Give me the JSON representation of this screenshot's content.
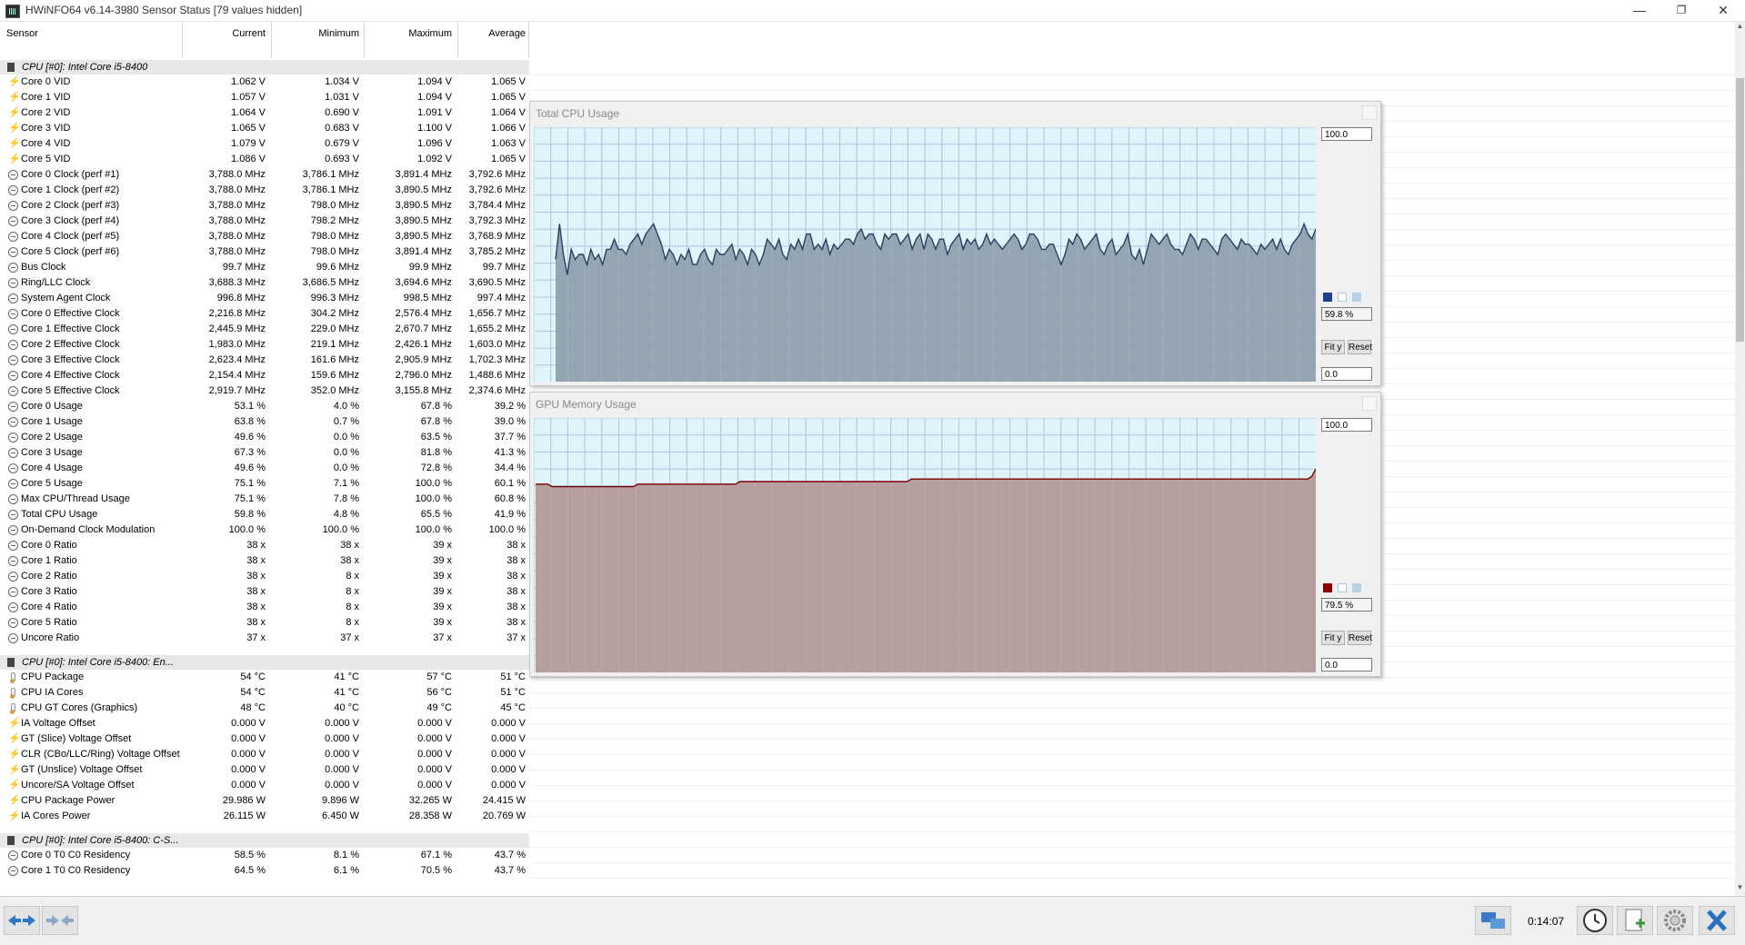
{
  "window": {
    "title": "HWiNFO64 v6.14-3980 Sensor Status [79 values hidden]",
    "controls": [
      "—",
      "❐",
      "✕"
    ]
  },
  "columns": {
    "sensor": "Sensor",
    "current": "Current",
    "minimum": "Minimum",
    "maximum": "Maximum",
    "average": "Average"
  },
  "groups": [
    {
      "title": "CPU [#0]: Intel Core i5-8400",
      "rows": [
        {
          "icon": "volt",
          "name": "Core 0 VID",
          "cur": "1.062 V",
          "min": "1.034 V",
          "max": "1.094 V",
          "avg": "1.065 V"
        },
        {
          "icon": "volt",
          "name": "Core 1 VID",
          "cur": "1.057 V",
          "min": "1.031 V",
          "max": "1.094 V",
          "avg": "1.065 V"
        },
        {
          "icon": "volt",
          "name": "Core 2 VID",
          "cur": "1.064 V",
          "min": "0.690 V",
          "max": "1.091 V",
          "avg": "1.064 V"
        },
        {
          "icon": "volt",
          "name": "Core 3 VID",
          "cur": "1.065 V",
          "min": "0.683 V",
          "max": "1.100 V",
          "avg": "1.066 V"
        },
        {
          "icon": "volt",
          "name": "Core 4 VID",
          "cur": "1.079 V",
          "min": "0.679 V",
          "max": "1.096 V",
          "avg": "1.063 V"
        },
        {
          "icon": "volt",
          "name": "Core 5 VID",
          "cur": "1.086 V",
          "min": "0.693 V",
          "max": "1.092 V",
          "avg": "1.065 V"
        },
        {
          "icon": "clock",
          "name": "Core 0 Clock (perf #1)",
          "cur": "3,788.0 MHz",
          "min": "3,786.1 MHz",
          "max": "3,891.4 MHz",
          "avg": "3,792.6 MHz"
        },
        {
          "icon": "clock",
          "name": "Core 1 Clock (perf #2)",
          "cur": "3,788.0 MHz",
          "min": "3,786.1 MHz",
          "max": "3,890.5 MHz",
          "avg": "3,792.6 MHz"
        },
        {
          "icon": "clock",
          "name": "Core 2 Clock (perf #3)",
          "cur": "3,788.0 MHz",
          "min": "798.0 MHz",
          "max": "3,890.5 MHz",
          "avg": "3,784.4 MHz"
        },
        {
          "icon": "clock",
          "name": "Core 3 Clock (perf #4)",
          "cur": "3,788.0 MHz",
          "min": "798.2 MHz",
          "max": "3,890.5 MHz",
          "avg": "3,792.3 MHz"
        },
        {
          "icon": "clock",
          "name": "Core 4 Clock (perf #5)",
          "cur": "3,788.0 MHz",
          "min": "798.0 MHz",
          "max": "3,890.5 MHz",
          "avg": "3,768.9 MHz"
        },
        {
          "icon": "clock",
          "name": "Core 5 Clock (perf #6)",
          "cur": "3,788.0 MHz",
          "min": "798.0 MHz",
          "max": "3,891.4 MHz",
          "avg": "3,785.2 MHz"
        },
        {
          "icon": "clock",
          "name": "Bus Clock",
          "cur": "99.7 MHz",
          "min": "99.6 MHz",
          "max": "99.9 MHz",
          "avg": "99.7 MHz"
        },
        {
          "icon": "clock",
          "name": "Ring/LLC Clock",
          "cur": "3,688.3 MHz",
          "min": "3,686.5 MHz",
          "max": "3,694.6 MHz",
          "avg": "3,690.5 MHz"
        },
        {
          "icon": "clock",
          "name": "System Agent Clock",
          "cur": "996.8 MHz",
          "min": "996.3 MHz",
          "max": "998.5 MHz",
          "avg": "997.4 MHz"
        },
        {
          "icon": "clock",
          "name": "Core 0 Effective Clock",
          "cur": "2,216.8 MHz",
          "min": "304.2 MHz",
          "max": "2,576.4 MHz",
          "avg": "1,656.7 MHz"
        },
        {
          "icon": "clock",
          "name": "Core 1 Effective Clock",
          "cur": "2,445.9 MHz",
          "min": "229.0 MHz",
          "max": "2,670.7 MHz",
          "avg": "1,655.2 MHz"
        },
        {
          "icon": "clock",
          "name": "Core 2 Effective Clock",
          "cur": "1,983.0 MHz",
          "min": "219.1 MHz",
          "max": "2,426.1 MHz",
          "avg": "1,603.0 MHz"
        },
        {
          "icon": "clock",
          "name": "Core 3 Effective Clock",
          "cur": "2,623.4 MHz",
          "min": "161.6 MHz",
          "max": "2,905.9 MHz",
          "avg": "1,702.3 MHz"
        },
        {
          "icon": "clock",
          "name": "Core 4 Effective Clock",
          "cur": "2,154.4 MHz",
          "min": "159.6 MHz",
          "max": "2,796.0 MHz",
          "avg": "1,488.6 MHz"
        },
        {
          "icon": "clock",
          "name": "Core 5 Effective Clock",
          "cur": "2,919.7 MHz",
          "min": "352.0 MHz",
          "max": "3,155.8 MHz",
          "avg": "2,374.6 MHz"
        },
        {
          "icon": "clock",
          "name": "Core 0 Usage",
          "cur": "53.1 %",
          "min": "4.0 %",
          "max": "67.8 %",
          "avg": "39.2 %"
        },
        {
          "icon": "clock",
          "name": "Core 1 Usage",
          "cur": "63.8 %",
          "min": "0.7 %",
          "max": "67.8 %",
          "avg": "39.0 %"
        },
        {
          "icon": "clock",
          "name": "Core 2 Usage",
          "cur": "49.6 %",
          "min": "0.0 %",
          "max": "63.5 %",
          "avg": "37.7 %"
        },
        {
          "icon": "clock",
          "name": "Core 3 Usage",
          "cur": "67.3 %",
          "min": "0.0 %",
          "max": "81.8 %",
          "avg": "41.3 %"
        },
        {
          "icon": "clock",
          "name": "Core 4 Usage",
          "cur": "49.6 %",
          "min": "0.0 %",
          "max": "72.8 %",
          "avg": "34.4 %"
        },
        {
          "icon": "clock",
          "name": "Core 5 Usage",
          "cur": "75.1 %",
          "min": "7.1 %",
          "max": "100.0 %",
          "avg": "60.1 %"
        },
        {
          "icon": "clock",
          "name": "Max CPU/Thread Usage",
          "cur": "75.1 %",
          "min": "7.8 %",
          "max": "100.0 %",
          "avg": "60.8 %"
        },
        {
          "icon": "clock",
          "name": "Total CPU Usage",
          "cur": "59.8 %",
          "min": "4.8 %",
          "max": "65.5 %",
          "avg": "41.9 %"
        },
        {
          "icon": "clock",
          "name": "On-Demand Clock Modulation",
          "cur": "100.0 %",
          "min": "100.0 %",
          "max": "100.0 %",
          "avg": "100.0 %"
        },
        {
          "icon": "clock",
          "name": "Core 0 Ratio",
          "cur": "38 x",
          "min": "38 x",
          "max": "39 x",
          "avg": "38 x"
        },
        {
          "icon": "clock",
          "name": "Core 1 Ratio",
          "cur": "38 x",
          "min": "38 x",
          "max": "39 x",
          "avg": "38 x"
        },
        {
          "icon": "clock",
          "name": "Core 2 Ratio",
          "cur": "38 x",
          "min": "8 x",
          "max": "39 x",
          "avg": "38 x"
        },
        {
          "icon": "clock",
          "name": "Core 3 Ratio",
          "cur": "38 x",
          "min": "8 x",
          "max": "39 x",
          "avg": "38 x"
        },
        {
          "icon": "clock",
          "name": "Core 4 Ratio",
          "cur": "38 x",
          "min": "8 x",
          "max": "39 x",
          "avg": "38 x"
        },
        {
          "icon": "clock",
          "name": "Core 5 Ratio",
          "cur": "38 x",
          "min": "8 x",
          "max": "39 x",
          "avg": "38 x"
        },
        {
          "icon": "clock",
          "name": "Uncore Ratio",
          "cur": "37 x",
          "min": "37 x",
          "max": "37 x",
          "avg": "37 x"
        }
      ]
    },
    {
      "title": "CPU [#0]: Intel Core i5-8400: En...",
      "rows": [
        {
          "icon": "temp",
          "name": "CPU Package",
          "cur": "54 °C",
          "min": "41 °C",
          "max": "57 °C",
          "avg": "51 °C"
        },
        {
          "icon": "temp",
          "name": "CPU IA Cores",
          "cur": "54 °C",
          "min": "41 °C",
          "max": "56 °C",
          "avg": "51 °C"
        },
        {
          "icon": "temp",
          "name": "CPU GT Cores (Graphics)",
          "cur": "48 °C",
          "min": "40 °C",
          "max": "49 °C",
          "avg": "45 °C"
        },
        {
          "icon": "volt",
          "name": "IA Voltage Offset",
          "cur": "0.000 V",
          "min": "0.000 V",
          "max": "0.000 V",
          "avg": "0.000 V"
        },
        {
          "icon": "volt",
          "name": "GT (Slice) Voltage Offset",
          "cur": "0.000 V",
          "min": "0.000 V",
          "max": "0.000 V",
          "avg": "0.000 V"
        },
        {
          "icon": "volt",
          "name": "CLR (CBo/LLC/Ring) Voltage Offset",
          "cur": "0.000 V",
          "min": "0.000 V",
          "max": "0.000 V",
          "avg": "0.000 V"
        },
        {
          "icon": "volt",
          "name": "GT (Unslice) Voltage Offset",
          "cur": "0.000 V",
          "min": "0.000 V",
          "max": "0.000 V",
          "avg": "0.000 V"
        },
        {
          "icon": "volt",
          "name": "Uncore/SA Voltage Offset",
          "cur": "0.000 V",
          "min": "0.000 V",
          "max": "0.000 V",
          "avg": "0.000 V"
        },
        {
          "icon": "volt",
          "name": "CPU Package Power",
          "cur": "29.986 W",
          "min": "9.896 W",
          "max": "32.265 W",
          "avg": "24.415 W"
        },
        {
          "icon": "volt",
          "name": "IA Cores Power",
          "cur": "26.115 W",
          "min": "6.450 W",
          "max": "28.358 W",
          "avg": "20.769 W"
        }
      ]
    },
    {
      "title": "CPU [#0]: Intel Core i5-8400: C-S...",
      "rows": [
        {
          "icon": "clock",
          "name": "Core 0 T0 C0 Residency",
          "cur": "58.5 %",
          "min": "8.1 %",
          "max": "67.1 %",
          "avg": "43.7 %"
        },
        {
          "icon": "clock",
          "name": "Core 1 T0 C0 Residency",
          "cur": "64.5 %",
          "min": "6.1 %",
          "max": "70.5 %",
          "avg": "43.7 %"
        }
      ]
    }
  ],
  "graphs": [
    {
      "title": "Total CPU Usage",
      "top": "100.0",
      "bottom": "0.0",
      "current": "59.8 %",
      "fit": "Fit y",
      "reset": "Reset",
      "color": "#1f3f8c",
      "fill": "#8fa0b0",
      "line": "#2a3f5e",
      "bg": "#e0f4fb",
      "chart_data": {
        "type": "area",
        "ylim": [
          0,
          100
        ],
        "values": [
          48,
          62,
          50,
          42,
          52,
          48,
          50,
          50,
          46,
          52,
          48,
          50,
          46,
          52,
          52,
          56,
          52,
          52,
          50,
          54,
          56,
          58,
          54,
          58,
          60,
          62,
          58,
          54,
          48,
          52,
          50,
          46,
          50,
          48,
          52,
          46,
          46,
          50,
          52,
          48,
          46,
          52,
          50,
          50,
          52,
          54,
          48,
          52,
          50,
          46,
          52,
          50,
          46,
          50,
          56,
          54,
          52,
          56,
          50,
          48,
          54,
          52,
          56,
          52,
          58,
          58,
          52,
          54,
          52,
          56,
          50,
          54,
          52,
          54,
          56,
          56,
          54,
          58,
          60,
          56,
          58,
          58,
          54,
          52,
          58,
          56,
          58,
          58,
          54,
          56,
          58,
          52,
          56,
          58,
          52,
          58,
          56,
          52,
          56,
          56,
          50,
          54,
          56,
          58,
          52,
          56,
          54,
          56,
          52,
          54,
          58,
          54,
          56,
          54,
          52,
          54,
          56,
          58,
          56,
          52,
          54,
          58,
          58,
          56,
          52,
          52,
          54,
          54,
          50,
          46,
          50,
          56,
          54,
          58,
          56,
          52,
          54,
          56,
          58,
          52,
          50,
          54,
          56,
          50,
          52,
          54,
          58,
          50,
          48,
          52,
          46,
          52,
          58,
          56,
          54,
          56,
          58,
          54,
          52,
          52,
          50,
          54,
          58,
          56,
          52,
          56,
          56,
          54,
          52,
          50,
          56,
          58,
          56,
          54,
          52,
          56,
          54,
          54,
          52,
          50,
          54,
          52,
          54,
          56,
          52,
          56,
          52,
          50,
          54,
          56,
          58,
          62,
          58,
          56,
          60
        ]
      }
    },
    {
      "title": "GPU Memory Usage",
      "top": "100.0",
      "bottom": "0.0",
      "current": "79.5 %",
      "fit": "Fit y",
      "reset": "Reset",
      "color": "#8a0000",
      "fill": "#b59a9a",
      "line": "#7a0000",
      "bg": "#e0f4fb",
      "chart_data": {
        "type": "area",
        "ylim": [
          0,
          100
        ],
        "values": [
          74,
          74,
          74,
          74,
          73,
          73,
          73,
          73,
          73,
          73,
          73,
          73,
          73,
          73,
          73,
          73,
          73,
          73,
          73,
          73,
          73,
          73,
          73,
          73,
          73,
          74,
          74,
          74,
          74,
          74,
          74,
          74,
          74,
          74,
          74,
          74,
          74,
          74,
          74,
          74,
          74,
          74,
          74,
          74,
          74,
          74,
          74,
          74,
          74,
          74,
          75,
          75,
          75,
          75,
          75,
          75,
          75,
          75,
          75,
          75,
          75,
          75,
          75,
          75,
          75,
          75,
          75,
          75,
          75,
          75,
          75,
          75,
          75,
          75,
          75,
          75,
          75,
          75,
          75,
          75,
          75,
          75,
          75,
          75,
          75,
          75,
          75,
          75,
          75,
          75,
          75,
          75,
          76,
          76,
          76,
          76,
          76,
          76,
          76,
          76,
          76,
          76,
          76,
          76,
          76,
          76,
          76,
          76,
          76,
          76,
          76,
          76,
          76,
          76,
          76,
          76,
          76,
          76,
          76,
          76,
          76,
          76,
          76,
          76,
          76,
          76,
          76,
          76,
          76,
          76,
          76,
          76,
          76,
          76,
          76,
          76,
          76,
          76,
          76,
          76,
          76,
          76,
          76,
          76,
          76,
          76,
          76,
          76,
          76,
          76,
          76,
          76,
          76,
          76,
          76,
          76,
          76,
          76,
          76,
          76,
          76,
          76,
          76,
          76,
          76,
          76,
          76,
          76,
          76,
          76,
          76,
          76,
          76,
          76,
          76,
          76,
          76,
          76,
          76,
          76,
          76,
          76,
          76,
          76,
          76,
          76,
          76,
          76,
          76,
          76,
          77,
          80
        ]
      }
    }
  ],
  "status": {
    "timer": "0:14:07"
  }
}
